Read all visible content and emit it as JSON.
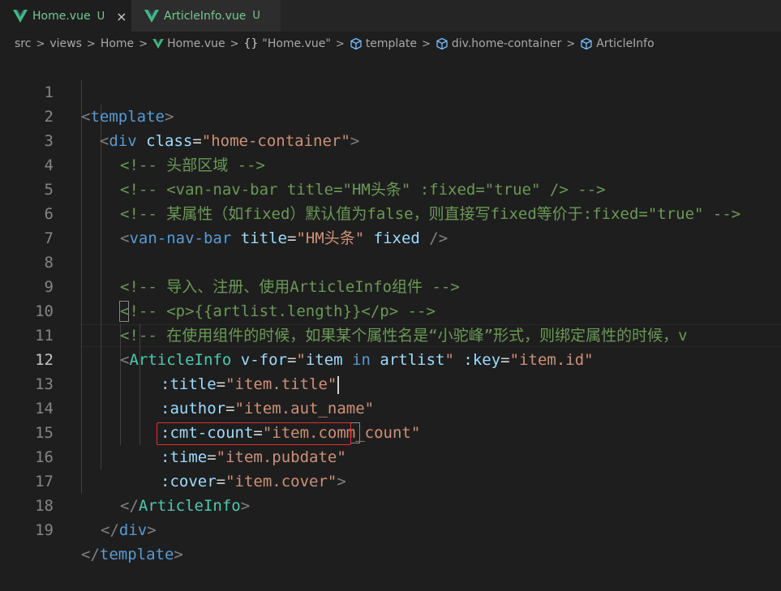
{
  "tabs": [
    {
      "label": "Home.vue",
      "badge": "U",
      "close": "×",
      "active": true
    },
    {
      "label": "ArticleInfo.vue",
      "badge": "U",
      "active": false
    }
  ],
  "breadcrumb": {
    "items": [
      "src",
      "views",
      "Home",
      "Home.vue",
      "\"Home.vue\"",
      "template",
      "div.home-container",
      "ArticleInfo"
    ],
    "braces": "{}",
    "separator": ">"
  },
  "lines": {
    "n1": "1",
    "n2": "2",
    "n3": "3",
    "n4": "4",
    "n5": "5",
    "n6": "6",
    "n7": "7",
    "n8": "8",
    "n9": "9",
    "n10": "10",
    "n11": "11",
    "n12": "12",
    "n13": "13",
    "n14": "14",
    "n15": "15",
    "n16": "16",
    "n17": "17",
    "n18": "18",
    "n19": "19",
    "l1": {
      "open": "<",
      "tag": "template",
      "close": ">"
    },
    "l2": {
      "open": "<",
      "tag": "div",
      "attr": "class",
      "eq": "=",
      "str": "\"home-container\"",
      "close": ">"
    },
    "l3": "<!-- 头部区域 -->",
    "l4": "<!-- <van-nav-bar title=\"HM头条\" :fixed=\"true\" /> -->",
    "l5": "<!-- 某属性（如fixed）默认值为false，则直接写fixed等价于:fixed=\"true\" -->",
    "l6": {
      "open": "<",
      "tag": "van-nav-bar",
      "attr1": "title",
      "eq": "=",
      "str": "\"HM头条\"",
      "attr2": "fixed",
      "close": "/>"
    },
    "l8": "<!-- 导入、注册、使用ArticleInfo组件 -->",
    "l9": "<!-- <p>{{artlist.length}}</p> -->",
    "l10": "<!-- 在使用组件的时候，如果某个属性名是“小驼峰”形式，则绑定属性的时候，v",
    "l11": {
      "open": "<",
      "comp": "ArticleInfo",
      "attr1": "v-for",
      "eq": "=",
      "q": "\"",
      "s1": "item",
      "kw": "in",
      "s2": "artlist",
      "attr2": ":key",
      "str2": "\"item.id\""
    },
    "l12": {
      "attr": ":title",
      "eq": "=",
      "str": "\"item.title\""
    },
    "l13": {
      "attr": ":author",
      "eq": "=",
      "str": "\"item.aut_name\""
    },
    "l14": {
      "attr": ":cmt-count",
      "eq": "=",
      "str": "\"item.comm_count\""
    },
    "l15": {
      "attr": ":time",
      "eq": "=",
      "str": "\"item.pubdate\""
    },
    "l16": {
      "attr": ":cover",
      "eq": "=",
      "str": "\"item.cover\"",
      "close": ">"
    },
    "l17": {
      "open": "</",
      "comp": "ArticleInfo",
      "close": ">"
    },
    "l18": {
      "open": "</",
      "tag": "div",
      "close": ">"
    },
    "l19": {
      "open": "</",
      "tag": "template",
      "close": ">"
    }
  },
  "colors": {
    "background": "#1e1e1e",
    "tag": "#569cd6",
    "component": "#4ec9b0",
    "attribute": "#9cdcfe",
    "string": "#ce9178",
    "comment": "#6a9955",
    "highlight": "#e03030",
    "untracked": "#73c991"
  },
  "icons": [
    "vue-icon",
    "cube-icon",
    "close-icon"
  ]
}
